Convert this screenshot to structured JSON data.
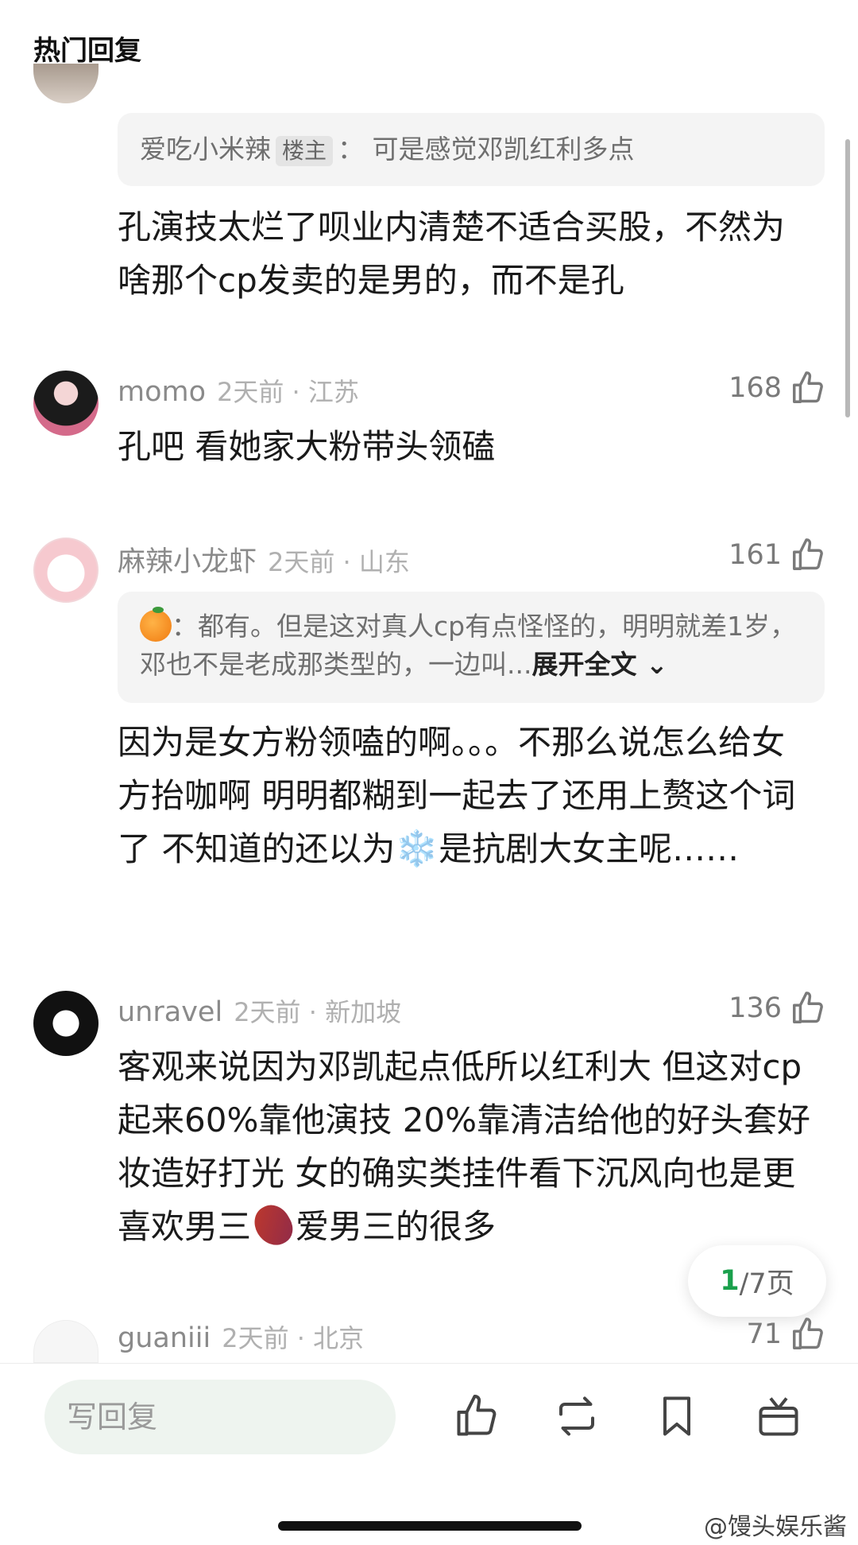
{
  "header": {
    "title": "热门回复"
  },
  "comments": [
    {
      "quote": {
        "author": "爱吃小米辣",
        "badge": "楼主",
        "sep": "：",
        "text": "可是感觉邓凯红利多点"
      },
      "text": "孔演技太烂了呗业内清楚不适合买股，不然为啥那个cp发卖的是男的，而不是孔"
    },
    {
      "name": "momo",
      "meta": "2天前 · 江苏",
      "likes": "168",
      "text": "孔吧 看她家大粉带头领磕"
    },
    {
      "name": "麻辣小龙虾",
      "meta": "2天前 · 山东",
      "likes": "161",
      "quote": {
        "text": "：都有。但是这对真人cp有点怪怪的，明明就差1岁，邓也不是老成那类型的，一边叫...",
        "expand": "展开全文"
      },
      "text_before_emoji": "因为是女方粉领嗑的啊。。。不那么说怎么给女方抬咖啊 明明都糊到一起去了还用上赘这个词了 不知道的还以为",
      "emoji": "❄️",
      "text_after_emoji": "是抗剧大女主呢……"
    },
    {
      "name": "unravel",
      "meta": "2天前 · 新加坡",
      "likes": "136",
      "text_before_emoji": "客观来说因为邓凯起点低所以红利大 但这对cp起来60%靠他演技 20%靠清洁给他的好头套好妆造好打光 女的确实类挂件看下沉风向也是更喜欢男三",
      "text_after_emoji": "爱男三的很多"
    },
    {
      "name": "guaniii",
      "meta": "2天前 · 北京",
      "likes": "71"
    }
  ],
  "pager": {
    "current": "1",
    "total": "/7页"
  },
  "bottom_bar": {
    "reply_placeholder": "写回复"
  },
  "watermark": "@馒头娱乐酱"
}
